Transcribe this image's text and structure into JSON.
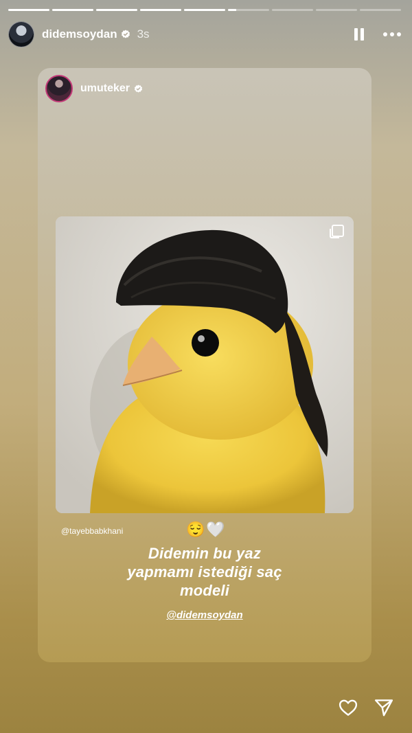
{
  "progress": [
    1,
    1,
    1,
    1,
    1,
    0.2,
    0,
    0,
    0
  ],
  "header": {
    "username": "didemsoydan",
    "time": "3s"
  },
  "card": {
    "username": "umuteker",
    "tag": "@tayebbabkhani",
    "emoji": "😌🤍",
    "caption_line1": "Didemin bu yaz",
    "caption_line2": "yapmamı istediği saç",
    "caption_line3": "modeli",
    "mention": "@didemsoydan"
  },
  "colors": {
    "chick_yellow": "#f3d13a",
    "hair": "#1c1a18",
    "verified": "#ffffff"
  },
  "icons": {
    "like": "heart-icon",
    "share": "send-icon",
    "multi": "multi-post-icon"
  }
}
